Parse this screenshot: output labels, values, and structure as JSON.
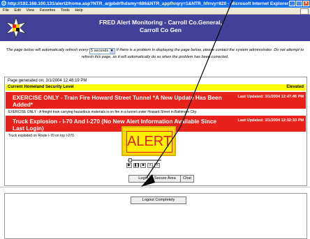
{
  "window": {
    "title": "http://192.168.100.131/alert2/home.asp?NTR_arjpbdrfhdsmy=686&NTR_appfhrqry=1&NTR_hfrrvy=820 - Microsoft Internet Explorer p"
  },
  "menu": {
    "items": [
      "File",
      "Edit",
      "View",
      "Favorites",
      "Tools",
      "Help"
    ]
  },
  "header": {
    "title_line1": "FRED Alert Monitoring - Carroll Co.General,",
    "title_line2": "Carroll Co Gen"
  },
  "refresh": {
    "text_before": "The page below will automatically refresh every",
    "interval": "5 seconds",
    "text_after": "If there is a problem in displaying the page below, please contact the system administrator. Do not attempt to refresh this page, as it will automatically do so when the problem has been corrected."
  },
  "status": {
    "generated": "Page generated on: 3/1/2004 12:48:19 PM",
    "level_label": "Current Homeland Security Level",
    "level_value": "Elevated",
    "level_color": "#ffff00"
  },
  "alerts": [
    {
      "title": "EXERCISE ONLY - Train Fire Howard Street Tunnel *A New Update Has Been Added*",
      "last_updated": "Last Updated: 3/1/2004 12:47:46 PM",
      "description": "EXERCISE ONLY - A freight train carrying hazardous materials is on fire in a tunnel under Howard Street in Baltimore City."
    },
    {
      "title": "Truck Explosion - I-70 And I-270 (No New Alert Information Available Since Last Login)",
      "last_updated": "Last Updated: 3/1/2004 12:32:33 PM",
      "description": "Truck exploded on Route I-70 on top I-270."
    }
  ],
  "alert_banner": {
    "text": "ALERT",
    "bg": "#ffd800",
    "text_color": "#e02020"
  },
  "player": {
    "controls": [
      "play-icon",
      "pause-icon",
      "stop-icon",
      "rewind-icon",
      "forward-icon"
    ]
  },
  "buttons": {
    "login_secure": "Login To Secure Area",
    "chat": "Chat",
    "logout": "Logout Completely"
  },
  "colors": {
    "header_bg": "#41419a",
    "alert_red": "#e8221b"
  }
}
